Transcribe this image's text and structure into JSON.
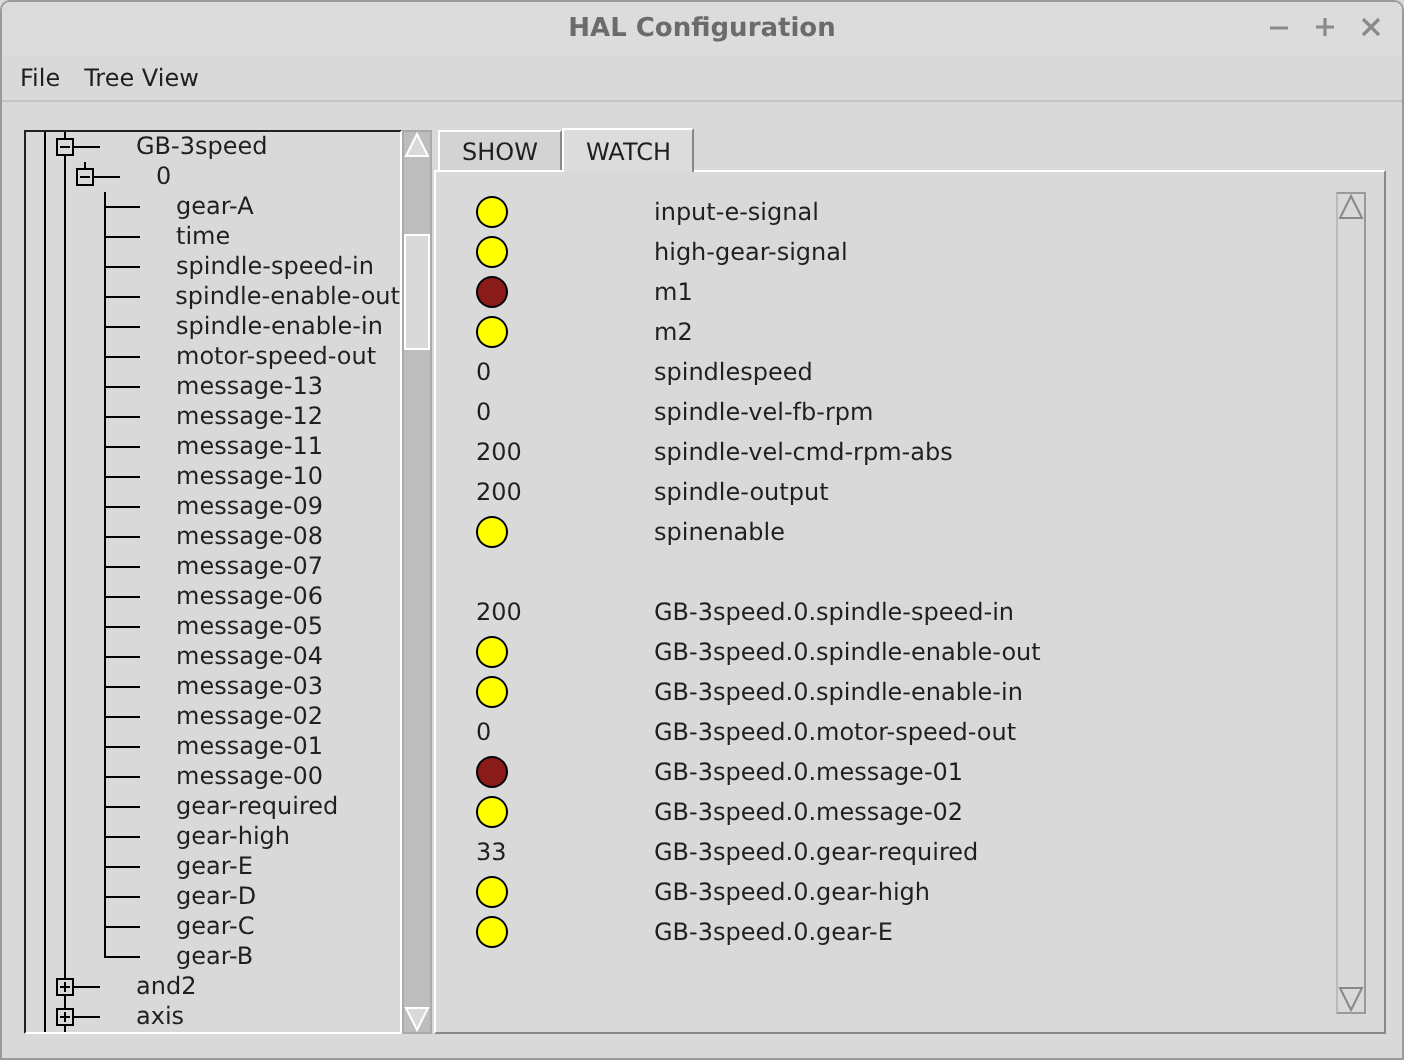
{
  "window": {
    "title": "HAL Configuration"
  },
  "menu": [
    "File",
    "Tree View"
  ],
  "tree": [
    {
      "label": "GB-3speed",
      "expanded": true,
      "children": [
        {
          "label": "0",
          "expanded": true,
          "children": [
            {
              "label": "gear-A"
            },
            {
              "label": "time"
            },
            {
              "label": "spindle-speed-in"
            },
            {
              "label": "spindle-enable-out"
            },
            {
              "label": "spindle-enable-in"
            },
            {
              "label": "motor-speed-out"
            },
            {
              "label": "message-13"
            },
            {
              "label": "message-12"
            },
            {
              "label": "message-11"
            },
            {
              "label": "message-10"
            },
            {
              "label": "message-09"
            },
            {
              "label": "message-08"
            },
            {
              "label": "message-07"
            },
            {
              "label": "message-06"
            },
            {
              "label": "message-05"
            },
            {
              "label": "message-04"
            },
            {
              "label": "message-03"
            },
            {
              "label": "message-02"
            },
            {
              "label": "message-01"
            },
            {
              "label": "message-00"
            },
            {
              "label": "gear-required"
            },
            {
              "label": "gear-high"
            },
            {
              "label": "gear-E"
            },
            {
              "label": "gear-D"
            },
            {
              "label": "gear-C"
            },
            {
              "label": "gear-B"
            }
          ]
        }
      ]
    },
    {
      "label": "and2",
      "expanded": false
    },
    {
      "label": "axis",
      "expanded": false
    }
  ],
  "tabs": [
    {
      "label": "SHOW",
      "selected": false
    },
    {
      "label": "WATCH",
      "selected": true
    }
  ],
  "watch_groups": [
    [
      {
        "kind": "led",
        "on": true,
        "name": "input-e-signal"
      },
      {
        "kind": "led",
        "on": true,
        "name": "high-gear-signal"
      },
      {
        "kind": "led",
        "on": false,
        "name": "m1"
      },
      {
        "kind": "led",
        "on": true,
        "name": "m2"
      },
      {
        "kind": "value",
        "value": "0",
        "name": "spindlespeed"
      },
      {
        "kind": "value",
        "value": "0",
        "name": "spindle-vel-fb-rpm"
      },
      {
        "kind": "value",
        "value": "200",
        "name": "spindle-vel-cmd-rpm-abs"
      },
      {
        "kind": "value",
        "value": "200",
        "name": "spindle-output"
      },
      {
        "kind": "led",
        "on": true,
        "name": "spinenable"
      }
    ],
    [
      {
        "kind": "value",
        "value": "200",
        "name": "GB-3speed.0.spindle-speed-in"
      },
      {
        "kind": "led",
        "on": true,
        "name": "GB-3speed.0.spindle-enable-out"
      },
      {
        "kind": "led",
        "on": true,
        "name": "GB-3speed.0.spindle-enable-in"
      },
      {
        "kind": "value",
        "value": "0",
        "name": "GB-3speed.0.motor-speed-out"
      },
      {
        "kind": "led",
        "on": false,
        "name": "GB-3speed.0.message-01"
      },
      {
        "kind": "led",
        "on": true,
        "name": "GB-3speed.0.message-02"
      },
      {
        "kind": "value",
        "value": "33",
        "name": "GB-3speed.0.gear-required"
      },
      {
        "kind": "led",
        "on": true,
        "name": "GB-3speed.0.gear-high"
      },
      {
        "kind": "led",
        "on": true,
        "name": "GB-3speed.0.gear-E"
      }
    ]
  ]
}
